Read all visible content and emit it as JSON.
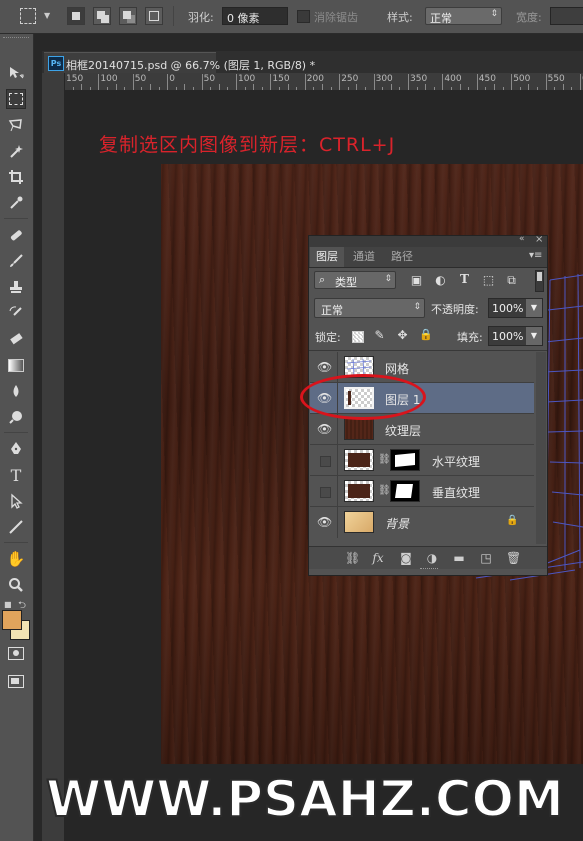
{
  "options_bar": {
    "feather_label": "羽化:",
    "feather_value": "0 像素",
    "antialias_label": "消除锯齿",
    "style_label": "样式:",
    "style_value": "正常",
    "width_label": "宽度:"
  },
  "document": {
    "tab_title": "相框20140715.psd @ 66.7% (图层 1, RGB/8) *",
    "ps_badge": "Ps",
    "ruler_labels": [
      "150",
      "100",
      "50",
      "0",
      "50",
      "100",
      "150",
      "200",
      "250",
      "300",
      "350",
      "400",
      "450",
      "500",
      "550",
      "60"
    ]
  },
  "annotation": "复制选区内图像到新层：CTRL+J",
  "layers_panel": {
    "tabs": [
      "图层",
      "通道",
      "路径"
    ],
    "filter_kind": "类型",
    "blend_mode": "正常",
    "opacity_label": "不透明度:",
    "opacity_value": "100%",
    "lock_label": "锁定:",
    "fill_label": "填充:",
    "fill_value": "100%",
    "layers": [
      {
        "name": "网格",
        "visible": true,
        "selected": false
      },
      {
        "name": "图层 1",
        "visible": true,
        "selected": true
      },
      {
        "name": "纹理层",
        "visible": true,
        "selected": false
      },
      {
        "name": "水平纹理",
        "visible": false,
        "selected": false
      },
      {
        "name": "垂直纹理",
        "visible": false,
        "selected": false
      },
      {
        "name": "背景",
        "visible": true,
        "selected": false,
        "locked": true
      }
    ],
    "footer_icons": [
      "link-icon",
      "fx-icon",
      "mask-icon",
      "adjustment-icon",
      "folder-icon",
      "new-layer-icon",
      "trash-icon"
    ],
    "fx_label": "fx"
  },
  "colors": {
    "foreground": "#e1a45c",
    "background": "#f2e3b3",
    "annotation": "#d9232b",
    "selection_highlight": "#5e6c86"
  },
  "watermark": "WWW.PSAHZ.COM"
}
